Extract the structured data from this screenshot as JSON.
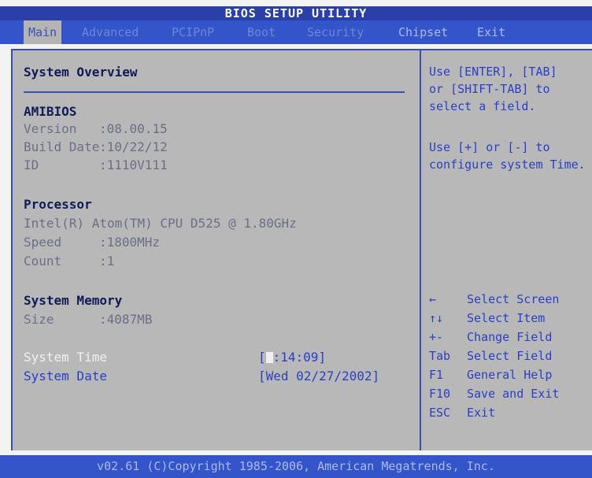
{
  "title": "BIOS SETUP UTILITY",
  "menu": [
    {
      "label": "Main",
      "active": true
    },
    {
      "label": "Advanced"
    },
    {
      "label": "PCIPnP"
    },
    {
      "label": "Boot"
    },
    {
      "label": "Security"
    },
    {
      "label": "Chipset"
    },
    {
      "label": "Exit"
    }
  ],
  "overview": {
    "heading": "System Overview",
    "amibios": {
      "heading": "AMIBIOS",
      "version_label": "Version",
      "version_value": ":08.00.15",
      "build_date_label": "Build Date",
      "build_date_value": ":10/22/12",
      "id_label": "ID",
      "id_value": ":1110V111"
    },
    "processor": {
      "heading": "Processor",
      "model": "Intel(R) Atom(TM) CPU D525   @ 1.80GHz",
      "speed_label": "Speed",
      "speed_value": ":1800MHz",
      "count_label": "Count",
      "count_value": ":1"
    },
    "memory": {
      "heading": "System Memory",
      "size_label": "Size",
      "size_value": ":4087MB"
    },
    "system_time": {
      "label": "System Time",
      "value_open": "[",
      "value_rest": ":14:09]"
    },
    "system_date": {
      "label": "System Date",
      "value": "[Wed 02/27/2002]"
    }
  },
  "help": {
    "lines": [
      "Use [ENTER], [TAB]",
      "or [SHIFT-TAB] to",
      "select a field.",
      "",
      "Use [+] or [-] to",
      "configure system Time."
    ]
  },
  "keys": [
    {
      "key": "←",
      "desc": "Select Screen"
    },
    {
      "key": "↑↓",
      "desc": "Select Item"
    },
    {
      "key": "+-",
      "desc": "Change Field"
    },
    {
      "key": "Tab",
      "desc": "Select Field"
    },
    {
      "key": "F1",
      "desc": "General Help"
    },
    {
      "key": "F10",
      "desc": "Save and Exit"
    },
    {
      "key": "ESC",
      "desc": "Exit"
    }
  ],
  "footer": "v02.61 (C)Copyright 1985-2006, American Megatrends, Inc."
}
